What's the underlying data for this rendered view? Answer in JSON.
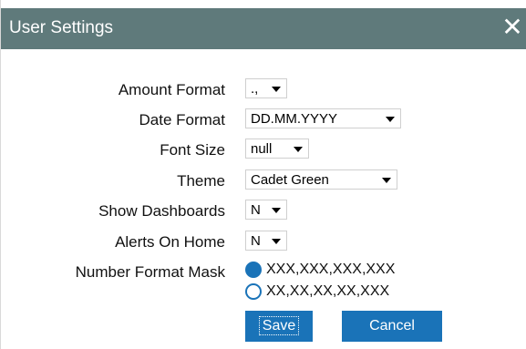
{
  "dialog": {
    "title": "User Settings",
    "close_symbol": "✕"
  },
  "fields": {
    "amount_format": {
      "label": "Amount Format",
      "value": ".,"
    },
    "date_format": {
      "label": "Date Format",
      "value": "DD.MM.YYYY"
    },
    "font_size": {
      "label": "Font Size",
      "value": "null"
    },
    "theme": {
      "label": "Theme",
      "value": "Cadet Green"
    },
    "show_dashboards": {
      "label": "Show Dashboards",
      "value": "N"
    },
    "alerts_on_home": {
      "label": "Alerts On Home",
      "value": "N"
    },
    "number_format_mask": {
      "label": "Number Format Mask",
      "options": [
        {
          "text": "XXX,XXX,XXX,XXX",
          "checked": true
        },
        {
          "text": "XX,XX,XX,XX,XXX",
          "checked": false
        }
      ]
    }
  },
  "buttons": {
    "save": "Save",
    "cancel": "Cancel"
  },
  "colors": {
    "titlebar": "#5f7a7b",
    "accent": "#1a73b8"
  }
}
